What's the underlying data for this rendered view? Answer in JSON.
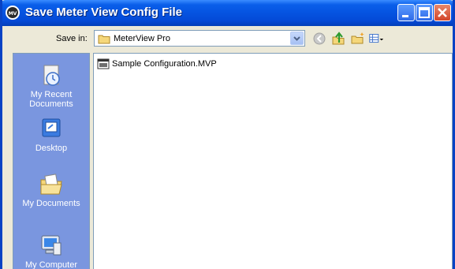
{
  "window": {
    "title": "Save Meter View Config File"
  },
  "toolbar": {
    "save_in_label": "Save in:",
    "save_in_value": "MeterView Pro"
  },
  "places": [
    {
      "label_line1": "My Recent",
      "label_line2": "Documents"
    },
    {
      "label_line1": "Desktop",
      "label_line2": ""
    },
    {
      "label_line1": "My Documents",
      "label_line2": ""
    },
    {
      "label_line1": "My Computer",
      "label_line2": ""
    }
  ],
  "files": [
    {
      "name": "Sample Configuration.MVP"
    }
  ],
  "colors": {
    "titlebar": "#0553E0",
    "places_bar": "#7A96DF",
    "dialog_bg": "#ECE9D8"
  }
}
